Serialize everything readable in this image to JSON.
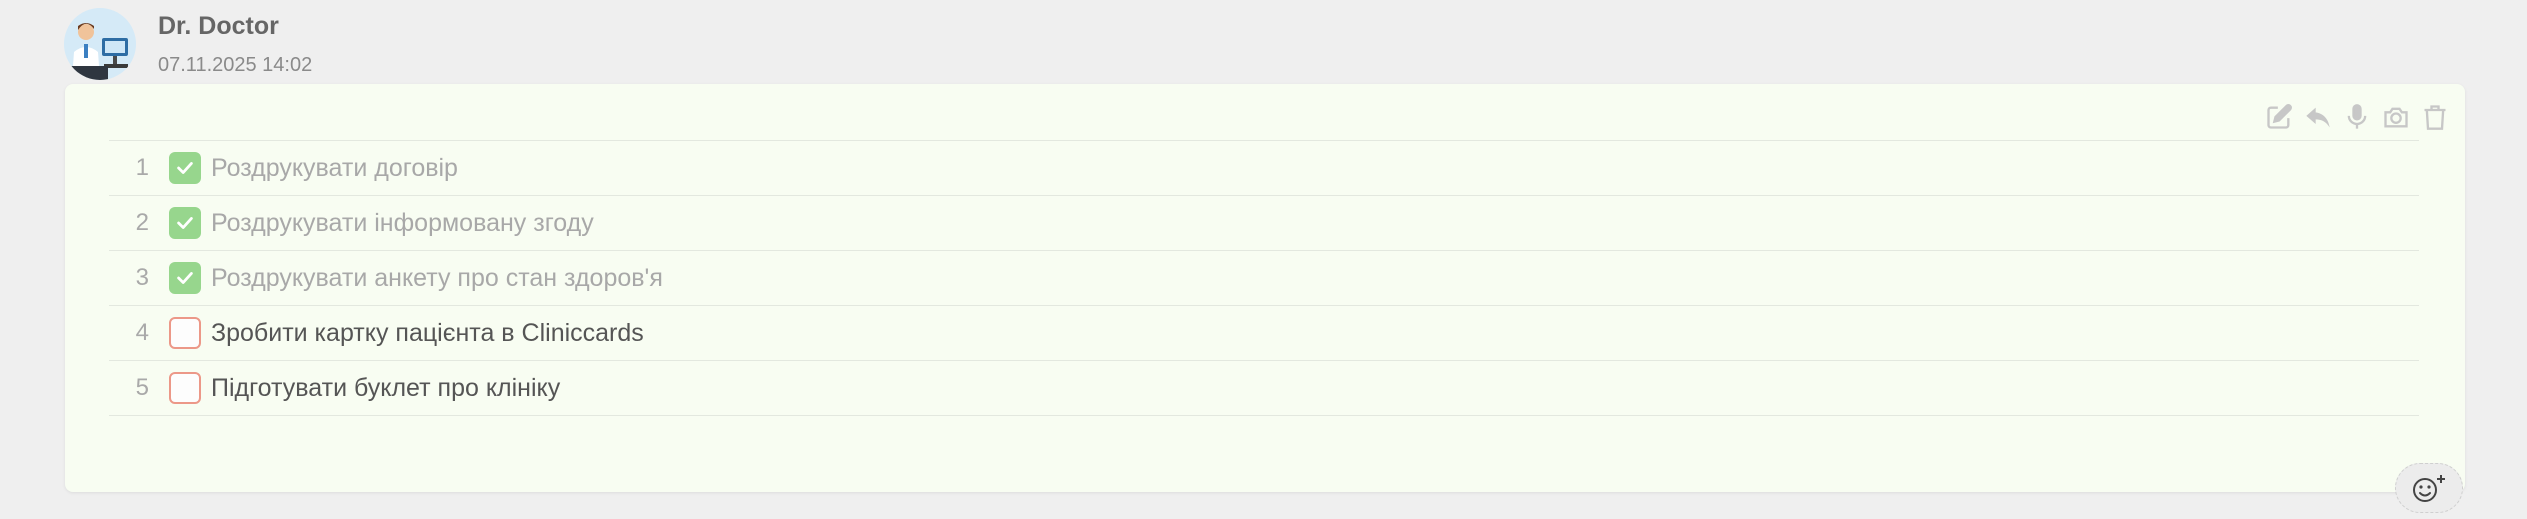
{
  "message": {
    "author": "Dr. Doctor",
    "timestamp": "07.11.2025 14:02"
  },
  "toolbar": {
    "icons": [
      "edit-icon",
      "reply-icon",
      "microphone-icon",
      "camera-icon",
      "trash-icon"
    ],
    "icon_color": "#c7c7c7"
  },
  "checklist": {
    "items": [
      {
        "number": "1",
        "label": "Роздрукувати договір",
        "checked": true
      },
      {
        "number": "2",
        "label": "Роздрукувати інформовану згоду",
        "checked": true
      },
      {
        "number": "3",
        "label": "Роздрукувати анкету про стан здоров'я",
        "checked": true
      },
      {
        "number": "4",
        "label": "Зробити картку пацієнта в Cliniccards",
        "checked": false
      },
      {
        "number": "5",
        "label": "Підготувати буклет про клініку",
        "checked": false
      }
    ]
  },
  "colors": {
    "card_background": "#f8fdf2",
    "checked_fill": "#97d68d",
    "unchecked_border": "#ec9888"
  },
  "reaction": {
    "icon": "add-emoji-icon"
  }
}
